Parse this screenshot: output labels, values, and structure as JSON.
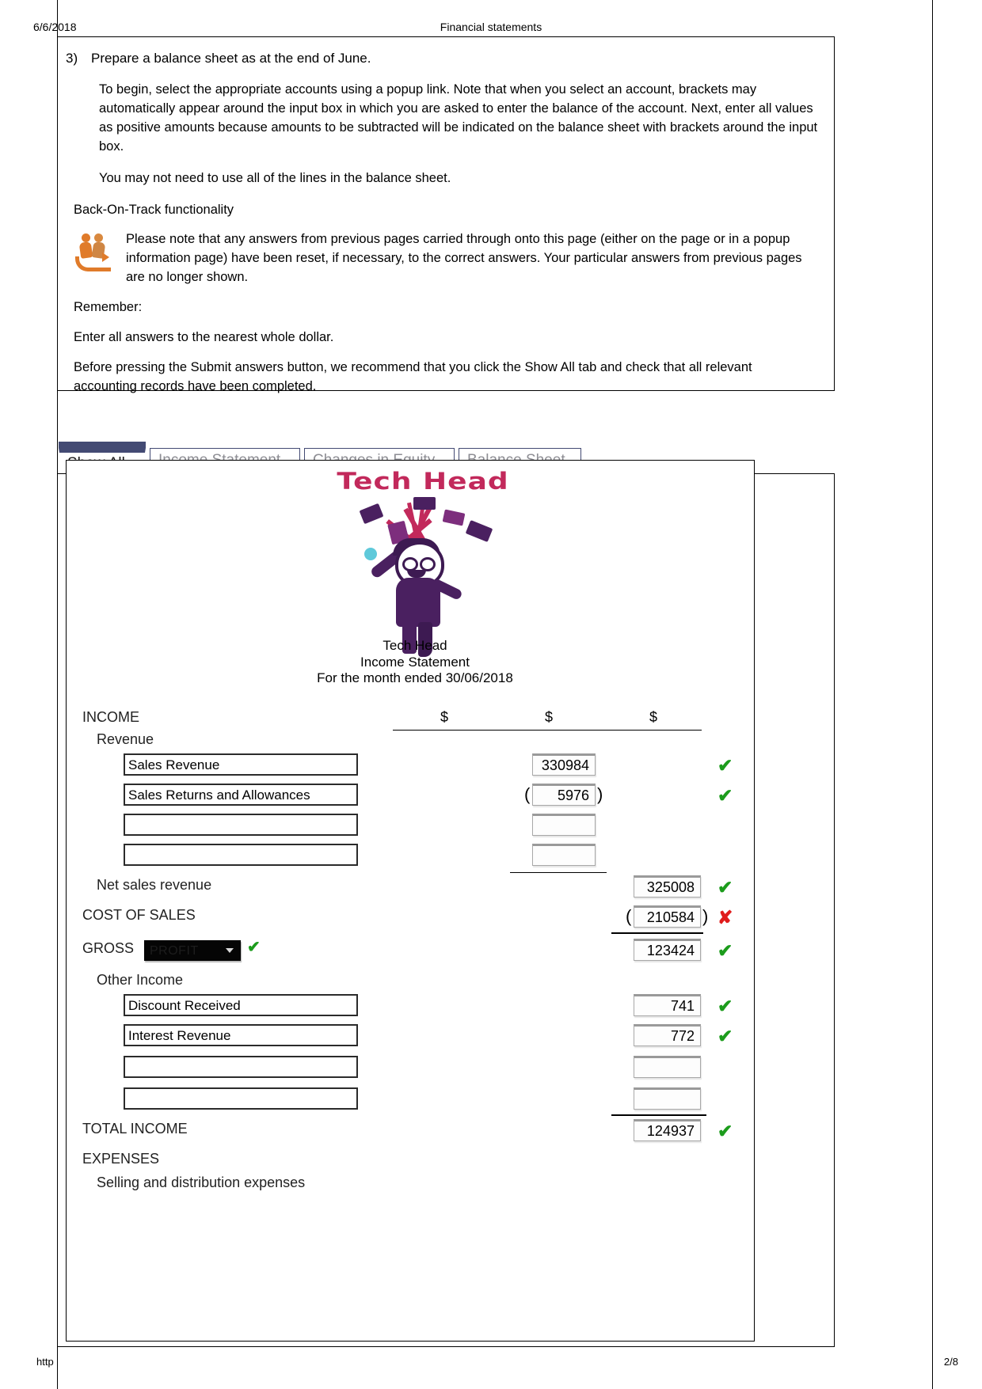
{
  "print": {
    "date": "6/6/2018",
    "title": "Financial statements",
    "url": "http",
    "page": "2/8"
  },
  "instructions": {
    "question_number": "3)",
    "question_text": "Prepare a balance sheet as at the end of June.",
    "paragraph_1": "To begin, select the appropriate accounts using a popup link. Note that when you select an account, brackets may automatically appear around the input box in which you are asked to enter the balance of the account. Next, enter all values as positive amounts because amounts to be subtracted will be indicated on the balance sheet with brackets around the input box.",
    "paragraph_2": "You may not need to use all of the lines in the balance sheet.",
    "back_on_track_heading": "Back-On-Track functionality",
    "back_on_track_note": "Please note that any answers from previous pages carried through onto this page (either on the page or in a popup information page) have been reset, if necessary, to the correct answers. Your particular answers from previous pages are no longer shown.",
    "remember_heading": "Remember:",
    "remember_line": "Enter all answers to the nearest whole dollar.",
    "submit_note": "Before pressing the Submit answers button, we recommend that you click the Show All tab and check that all relevant accounting records have been completed."
  },
  "tabs": [
    {
      "label": "Show All",
      "active": true
    },
    {
      "label": "Income Statement",
      "active": false
    },
    {
      "label": "Changes in Equity",
      "active": false
    },
    {
      "label": "Balance Sheet",
      "active": false
    }
  ],
  "statement": {
    "logo_text": "Tech Head",
    "company": "Tech Head",
    "title": "Income Statement",
    "period": "For the month ended 30/06/2018",
    "currency_headers": [
      "$",
      "$",
      "$"
    ],
    "sections": {
      "income_label": "INCOME",
      "revenue_label": "Revenue",
      "net_sales_label": "Net sales revenue",
      "cost_of_sales_label": "COST OF SALES",
      "gross_label": "GROSS",
      "gross_select_value": "PROFIT",
      "other_income_label": "Other Income",
      "total_income_label": "TOTAL INCOME",
      "expenses_label": "EXPENSES",
      "selling_label": "Selling and distribution expenses"
    },
    "revenue_rows": [
      {
        "account": "Sales Revenue",
        "amount": "330984",
        "bracketed": false,
        "mark": "check"
      },
      {
        "account": "Sales Returns and Allowances",
        "amount": "5976",
        "bracketed": true,
        "mark": "check"
      },
      {
        "account": "",
        "amount": "",
        "bracketed": false,
        "mark": ""
      },
      {
        "account": "",
        "amount": "",
        "bracketed": false,
        "mark": ""
      }
    ],
    "other_income_rows": [
      {
        "account": "Discount Received",
        "amount": "741",
        "bracketed": false,
        "mark": "check"
      },
      {
        "account": "Interest Revenue",
        "amount": "772",
        "bracketed": false,
        "mark": "check"
      },
      {
        "account": "",
        "amount": "",
        "bracketed": false,
        "mark": ""
      },
      {
        "account": "",
        "amount": "",
        "bracketed": false,
        "mark": ""
      }
    ],
    "totals": {
      "net_sales_revenue": "325008",
      "net_sales_mark": "check",
      "cost_of_sales": "210584",
      "cost_of_sales_bracketed": true,
      "cost_of_sales_mark": "cross",
      "gross_profit": "123424",
      "gross_profit_mark": "check",
      "total_income": "124937",
      "total_income_mark": "check"
    }
  },
  "colors": {
    "tab_accent": "#434a73",
    "check": "#1c9c1c",
    "cross": "#e01b1b",
    "logo_red": "#c2295b",
    "logo_purple": "#4a2060"
  },
  "glyphs": {
    "check": "✔",
    "cross": "✘"
  }
}
